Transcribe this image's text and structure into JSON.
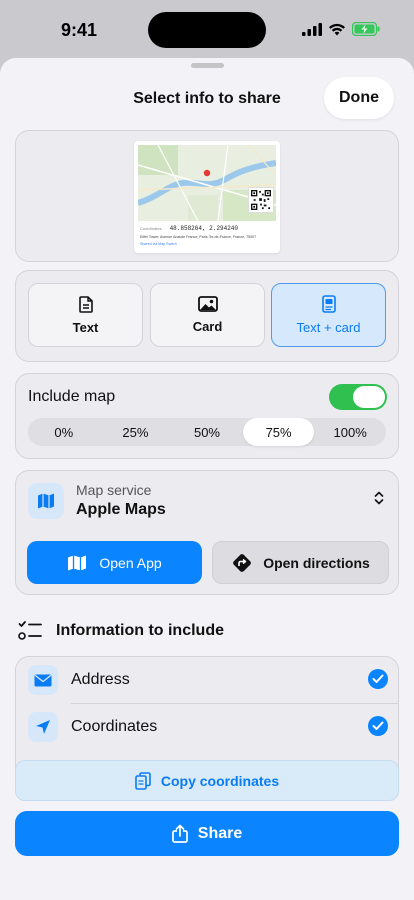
{
  "status_bar": {
    "time": "9:41"
  },
  "sheet": {
    "title": "Select info to share",
    "done_label": "Done"
  },
  "preview": {
    "coordinates_label": "Coordinates",
    "coordinates": "48.858264, 2.294240",
    "address": "Eiffel Tower, Avenue Anatole France, Paris, Île-de-France, France, 75007",
    "shared_via": "Shared via Map Switch"
  },
  "format": {
    "options": [
      {
        "label": "Text",
        "icon": "doc-text-icon"
      },
      {
        "label": "Card",
        "icon": "photo-icon"
      },
      {
        "label": "Text + card",
        "icon": "text-card-icon"
      }
    ],
    "selected": "Text + card"
  },
  "include_map": {
    "label": "Include map",
    "enabled": true,
    "options": [
      "0%",
      "25%",
      "50%",
      "75%",
      "100%"
    ],
    "selected": "75%"
  },
  "map_service": {
    "label": "Map service",
    "value": "Apple Maps",
    "open_app_label": "Open App",
    "open_directions_label": "Open directions"
  },
  "information": {
    "title": "Information to include",
    "items": [
      {
        "label": "Address",
        "icon": "envelope-icon",
        "checked": true
      },
      {
        "label": "Coordinates",
        "icon": "location-arrow-icon",
        "checked": true
      }
    ]
  },
  "actions": {
    "copy_label": "Copy coordinates",
    "share_label": "Share"
  },
  "colors": {
    "accent": "#0A84FF",
    "toggle_on": "#30C050",
    "sheet_bg": "#F2F2F7"
  }
}
